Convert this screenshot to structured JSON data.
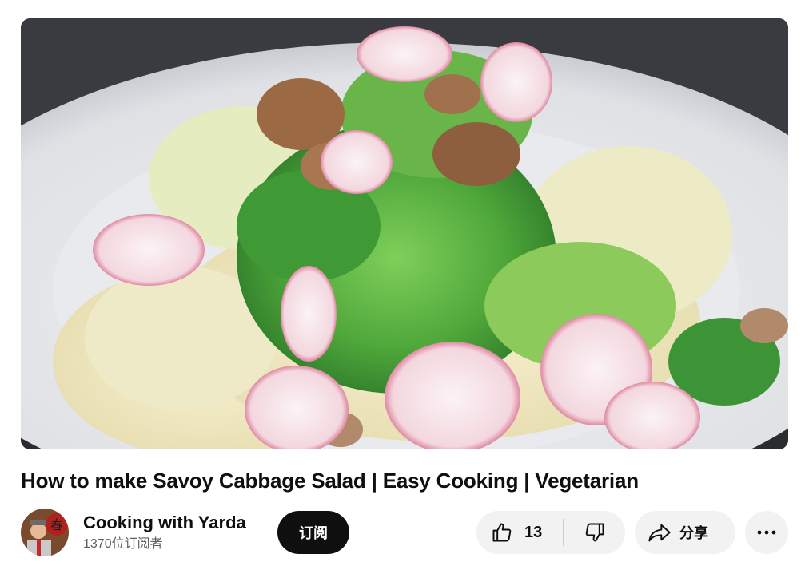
{
  "video": {
    "title": "How to make Savoy Cabbage Salad | Easy Cooking | Vegetarian",
    "thumbnail_description": "savoy-cabbage-salad-frame"
  },
  "channel": {
    "name": "Cooking with Yarda",
    "subscribers": "1370位订阅者",
    "avatar_icon": "channel-avatar"
  },
  "actions": {
    "subscribe_label": "订阅",
    "like_count": "13",
    "share_label": "分享",
    "icons": [
      "thumbs-up-icon",
      "thumbs-down-icon",
      "share-arrow-icon",
      "more-options-icon"
    ]
  },
  "colors": {
    "subscribe_bg": "#0f0f0f",
    "pill_bg": "#f2f2f2",
    "secondary_text": "#606060"
  }
}
